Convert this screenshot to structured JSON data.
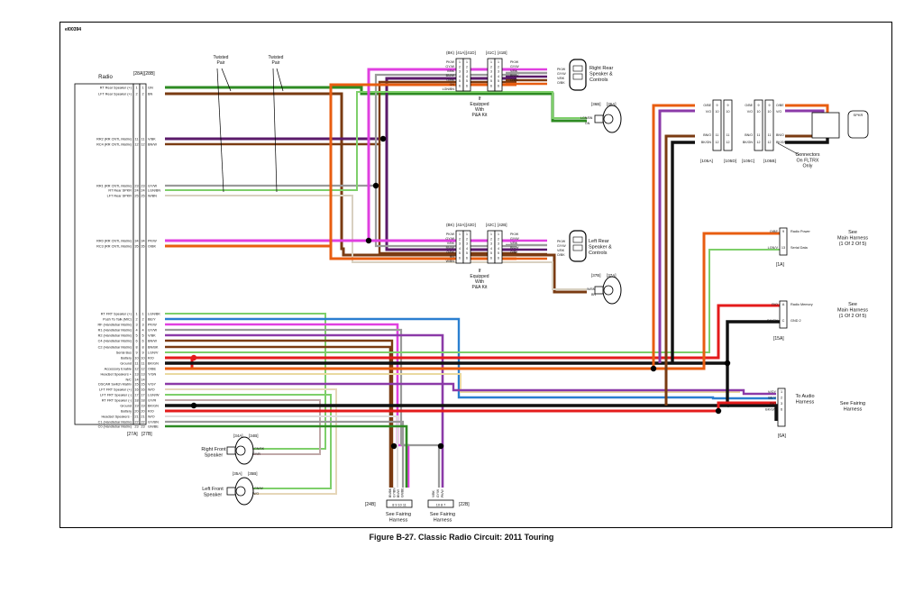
{
  "doc_id": "el00394",
  "caption": "Figure B-27. Classic Radio Circuit: 2011 Touring",
  "colors": {
    "green": "#2e8b23",
    "brown": "#7a3b12",
    "purple": "#5a1a6a",
    "violet": "#8b3aa8",
    "pink": "#e040e0",
    "orange": "#e85d10",
    "black": "#111111",
    "red": "#e41b1b",
    "grey": "#9a9a9a",
    "blue": "#2a7fd0",
    "white": "#f4f4f4",
    "lightgreen": "#7ecf6a",
    "cream": "#e9d9a0"
  },
  "radio": {
    "title": "Radio",
    "conn_top": [
      "[28A]",
      "[28B]"
    ],
    "conn_bottom": [
      "[27A]",
      "[27B]"
    ],
    "pins_top": [
      {
        "label": "RT Rear Speaker (+)",
        "pin": "1",
        "wire": "GN"
      },
      {
        "label": "LFT Rear Speaker (+)",
        "pin": "2",
        "wire": "BN"
      },
      {
        "label": "RR2 (RR CNTL Matrix)",
        "pin": "11",
        "wire": "V/BK"
      },
      {
        "label": "RC4 (RR CNTL Matrix)",
        "pin": "12",
        "wire": "BN/W"
      },
      {
        "label": "RR1 (RR CNTL Matrix)",
        "pin": "23",
        "wire": "GY/W"
      },
      {
        "label": "RT Rear SPKR",
        "pin": "24",
        "wire": "LGN/BN"
      },
      {
        "label": "LFT Rear SPKR",
        "pin": "25",
        "wire": "W/BN"
      },
      {
        "label": "RR0 (RR CNTL Matrix)",
        "pin": "34",
        "wire": "PK/W"
      },
      {
        "label": "RC3 (RR CNTL Matrix)",
        "pin": "35",
        "wire": "O/BK"
      }
    ],
    "pins_bottom": [
      {
        "label": "RT FRT Speaker (+)",
        "pin": "1",
        "wire": "LGN/BK"
      },
      {
        "label": "Push To Talk (MIC)",
        "pin": "2",
        "wire": "BE/Y"
      },
      {
        "label": "RF (Handlebar Matrix)",
        "pin": "3",
        "wire": "PK/W"
      },
      {
        "label": "R1 (Handlebar Matrix)",
        "pin": "4",
        "wire": "GY/W"
      },
      {
        "label": "R2 (Handlebar Matrix)",
        "pin": "5",
        "wire": "V/BK"
      },
      {
        "label": "C4 (Handlebar Matrix)",
        "pin": "6",
        "wire": "BN/W"
      },
      {
        "label": "C2 (Handlebar Matrix)",
        "pin": "8",
        "wire": "BN/BK"
      },
      {
        "label": "Serial Bus",
        "pin": "9",
        "wire": "LGN/V"
      },
      {
        "label": "Battery",
        "pin": "10",
        "wire": "R/O"
      },
      {
        "label": "Ground",
        "pin": "11",
        "wire": "BK/GN"
      },
      {
        "label": "Accessory Enable",
        "pin": "12",
        "wire": "O/BE"
      },
      {
        "label": "Headset Speakers +",
        "pin": "13",
        "wire": "Y/GN"
      },
      {
        "label": "N/C",
        "pin": "14",
        "wire": ""
      },
      {
        "label": "DSCAR Switch Matrix",
        "pin": "15",
        "wire": "V/GY"
      },
      {
        "label": "LFT FRT Speaker (+)",
        "pin": "16",
        "wire": "W/O"
      },
      {
        "label": "LFT FRT Speaker (-)",
        "pin": "17",
        "wire": "LGN/W"
      },
      {
        "label": "RT FRT Speaker (-)",
        "pin": "18",
        "wire": "GY/R"
      },
      {
        "label": "Ground",
        "pin": "19",
        "wire": "BK/GN"
      },
      {
        "label": "Battery",
        "pin": "20",
        "wire": "R/O"
      },
      {
        "label": "Headset Speakers -",
        "pin": "21",
        "wire": "W/O"
      },
      {
        "label": "C1 (Handlebar Matrix)",
        "pin": "22",
        "wire": "GY/BN"
      },
      {
        "label": "C0 (Handlebar Matrix)",
        "pin": "23",
        "wire": "GN/BE"
      }
    ]
  },
  "twisted_pair": [
    "Twisted Pair",
    "Twisted Pair"
  ],
  "right_rear": {
    "conns": [
      "(BK)",
      "[41A]",
      "[41D]",
      "[41C]",
      "[41B]"
    ],
    "wires": [
      "PK/W",
      "GY/W",
      "V/BK",
      "BN/W",
      "O/BK",
      "GN",
      "LGN/BN"
    ],
    "pins": [
      "1",
      "2",
      "3",
      "4",
      "5",
      "6"
    ],
    "note": [
      "If",
      "Equipped",
      "With",
      "P&A Kit"
    ],
    "label": [
      "Right Rear",
      "Speaker &",
      "Controls"
    ],
    "spk_conns": [
      "[36B]",
      "[36A]"
    ],
    "spk_wires": [
      "LGN/BN",
      "GN"
    ]
  },
  "left_rear": {
    "conns": [
      "(BK)",
      "[42A]",
      "[42D]",
      "[42C]",
      "[42B]"
    ],
    "wires": [
      "PK/W",
      "GY/W",
      "V/BK",
      "BN/W",
      "O/BK",
      "BN",
      "W/BN"
    ],
    "pins": [
      "1",
      "2",
      "3",
      "4",
      "5",
      "6"
    ],
    "note": [
      "If",
      "Equipped",
      "With",
      "P&A Kit"
    ],
    "label": [
      "Left Rear",
      "Speaker &",
      "Controls"
    ],
    "spk_conns": [
      "[37B]",
      "[37A]"
    ],
    "spk_wires": [
      "W/BN",
      "BN"
    ]
  },
  "fltrx": {
    "conns": [
      "[105A]",
      "[105D]",
      "[105C]",
      "[105B]"
    ],
    "pins": [
      "9",
      "10",
      "11",
      "12"
    ],
    "wires": [
      "O/BE",
      "V/O",
      "BN/O",
      "BK/GN"
    ],
    "label": [
      "Connectors",
      "On FLTRX",
      "Only"
    ],
    "spkr": "SPKR"
  },
  "right_side": {
    "c1": {
      "conn": "[1A]",
      "rows": [
        {
          "wire": "O/BE",
          "pin": "9",
          "label": "Radio Power"
        },
        {
          "wire": "LGN/V",
          "pin": "13",
          "label": "Serial Data"
        }
      ],
      "see": [
        "See",
        "Main Harness",
        "(1 Of 2 Of 5)"
      ]
    },
    "c2": {
      "conn": "[15A]",
      "rows": [
        {
          "wire": "R/O",
          "pin": "A",
          "label": "Radio Memory"
        },
        {
          "wire": "BK/GN",
          "pin": "C",
          "label": "GND 2"
        }
      ],
      "see": [
        "See",
        "Main Harness",
        "(1 Of 2 Of 5)"
      ]
    },
    "c3": {
      "conn": "[6A]",
      "rows": [
        {
          "wire": "V/GY",
          "pin": "1"
        },
        {
          "wire": "BE/Y",
          "pin": "2"
        },
        {
          "wire": "R/O",
          "pin": "3"
        },
        {
          "wire": "BK/GN",
          "pin": "6"
        }
      ],
      "to": [
        "To Audio",
        "Harness"
      ],
      "see": [
        "See Fairing",
        "Harness"
      ]
    }
  },
  "front": {
    "right": {
      "conns": [
        "[34A]",
        "[34B]"
      ],
      "label": [
        "Right Front",
        "Speaker"
      ],
      "wires": [
        "LGN/BK",
        "GY/R"
      ]
    },
    "left": {
      "conns": [
        "[35A]",
        "[35B]"
      ],
      "label": [
        "Left Front",
        "Speaker"
      ],
      "wires": [
        "LGN/W",
        "W/O"
      ]
    }
  },
  "fairing": {
    "c24": {
      "conn": "[24B]",
      "pins": "8 9 10 11",
      "wires": [
        "BN/BK",
        "GY/BN",
        "BN/W",
        "GN/BE"
      ],
      "see": [
        "See Fairing",
        "Harness"
      ]
    },
    "c22": {
      "conn": "[22B]",
      "pins": "10 8 7",
      "wires": [
        "V/BK",
        "GY/W",
        "PK/W"
      ],
      "see": [
        "See Fairing",
        "Harness"
      ]
    }
  }
}
